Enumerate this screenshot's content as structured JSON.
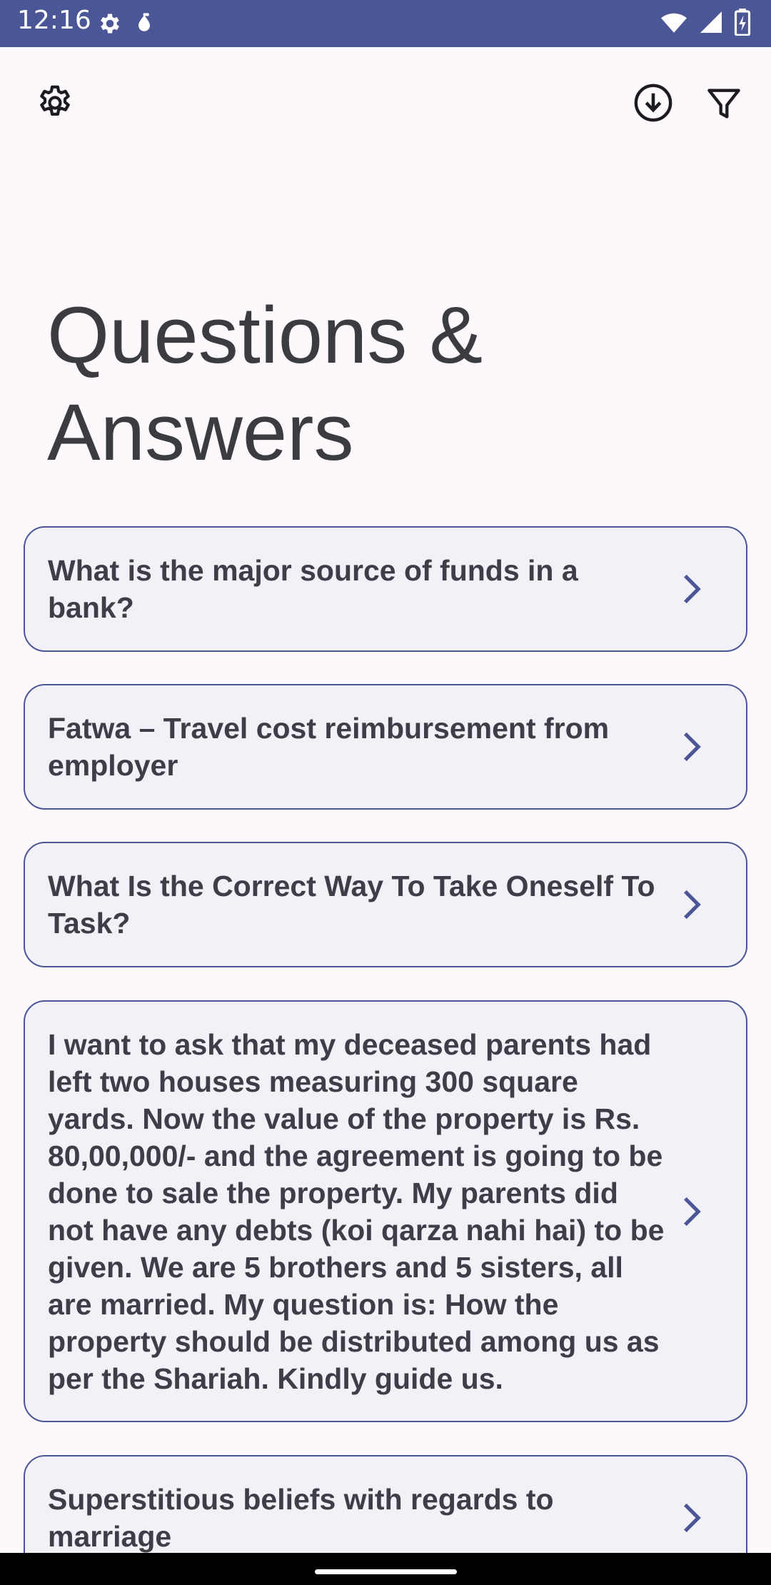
{
  "status_bar": {
    "time": "12:16",
    "left_icons": [
      "gear-icon",
      "drop-icon"
    ],
    "right_icons": [
      "wifi-icon",
      "signal-icon",
      "battery-charging-icon"
    ],
    "background": "#4a5696"
  },
  "toolbar": {
    "left_icon": "settings-icon",
    "right_icons": [
      "download-icon",
      "filter-icon"
    ]
  },
  "page_title": "Questions & Answers",
  "questions": [
    "What is the major source of funds in a bank?",
    "Fatwa – Travel cost reimbursement from employer",
    "What Is the Correct Way To Take Oneself To Task?",
    "I want to ask that my deceased parents had left two houses measuring 300 square yards. Now the value of the property is Rs. 80,00,000/- and the agreement is going to be done to sale the property. My parents did not have any debts (koi qarza nahi hai) to be given. We are 5 brothers and 5 sisters, all are married. My question is: How the property should be distributed among us as per the Shariah. Kindly guide us.",
    "Superstitious beliefs with regards to marriage"
  ],
  "colors": {
    "accent": "#4a5696",
    "card_background": "#f3f1f8",
    "page_background": "#fdf8fc",
    "text": "#3e3e46"
  }
}
